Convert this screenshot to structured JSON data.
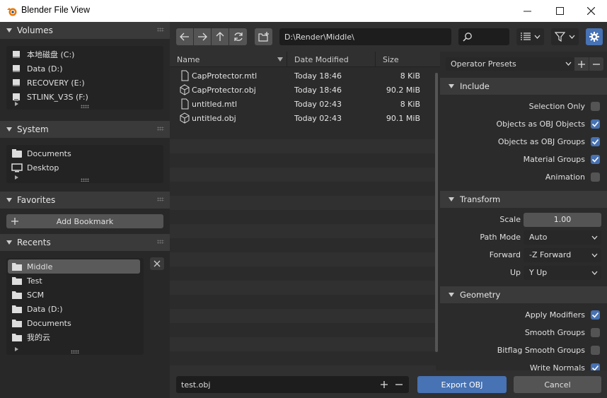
{
  "window": {
    "title": "Blender File View"
  },
  "left": {
    "volumes": {
      "title": "Volumes",
      "items": [
        {
          "label": "本地磁盘 (C:)",
          "icon": "drive-icon"
        },
        {
          "label": "Data (D:)",
          "icon": "drive-icon"
        },
        {
          "label": "RECOVERY (E:)",
          "icon": "drive-icon"
        },
        {
          "label": "STLINK_V3S (F:)",
          "icon": "usb-drive-icon"
        }
      ]
    },
    "system": {
      "title": "System",
      "items": [
        {
          "label": "Documents",
          "icon": "documents-icon"
        },
        {
          "label": "Desktop",
          "icon": "desktop-icon"
        }
      ]
    },
    "favorites": {
      "title": "Favorites",
      "add_label": "Add Bookmark"
    },
    "recents": {
      "title": "Recents",
      "items": [
        {
          "label": "Middle",
          "selected": true
        },
        {
          "label": "Test"
        },
        {
          "label": "SCM"
        },
        {
          "label": "Data (D:)"
        },
        {
          "label": "Documents"
        },
        {
          "label": "我的云"
        }
      ]
    }
  },
  "toolbar": {
    "path": "D:\\Render\\Middle\\",
    "search_placeholder": ""
  },
  "files": {
    "headers": {
      "name": "Name",
      "date": "Date Modified",
      "size": "Size"
    },
    "rows": [
      {
        "name": "CapProtector.mtl",
        "date": "Today 18:46",
        "size": "8 KiB",
        "type": "text"
      },
      {
        "name": "CapProtector.obj",
        "date": "Today 18:46",
        "size": "90.2 MiB",
        "type": "mesh"
      },
      {
        "name": "untitled.mtl",
        "date": "Today 02:43",
        "size": "8 KiB",
        "type": "text"
      },
      {
        "name": "untitled.obj",
        "date": "Today 02:43",
        "size": "90.1 MiB",
        "type": "mesh"
      }
    ]
  },
  "operator": {
    "presets_label": "Operator Presets",
    "include": {
      "title": "Include",
      "props": [
        {
          "label": "Selection Only",
          "checked": false
        },
        {
          "label": "Objects as OBJ Objects",
          "checked": true
        },
        {
          "label": "Objects as OBJ Groups",
          "checked": true
        },
        {
          "label": "Material Groups",
          "checked": true
        },
        {
          "label": "Animation",
          "checked": false
        }
      ]
    },
    "transform": {
      "title": "Transform",
      "scale_label": "Scale",
      "scale_value": "1.00",
      "path_mode_label": "Path Mode",
      "path_mode_value": "Auto",
      "forward_label": "Forward",
      "forward_value": "-Z Forward",
      "up_label": "Up",
      "up_value": "Y Up"
    },
    "geometry": {
      "title": "Geometry",
      "props": [
        {
          "label": "Apply Modifiers",
          "checked": true
        },
        {
          "label": "Smooth Groups",
          "checked": false
        },
        {
          "label": "Bitflag Smooth Groups",
          "checked": false
        },
        {
          "label": "Write Normals",
          "checked": true
        }
      ]
    }
  },
  "bottom": {
    "filename": "test.obj",
    "export_label": "Export OBJ",
    "cancel_label": "Cancel"
  },
  "colors": {
    "accent": "#4772b3",
    "background": "#303030"
  }
}
